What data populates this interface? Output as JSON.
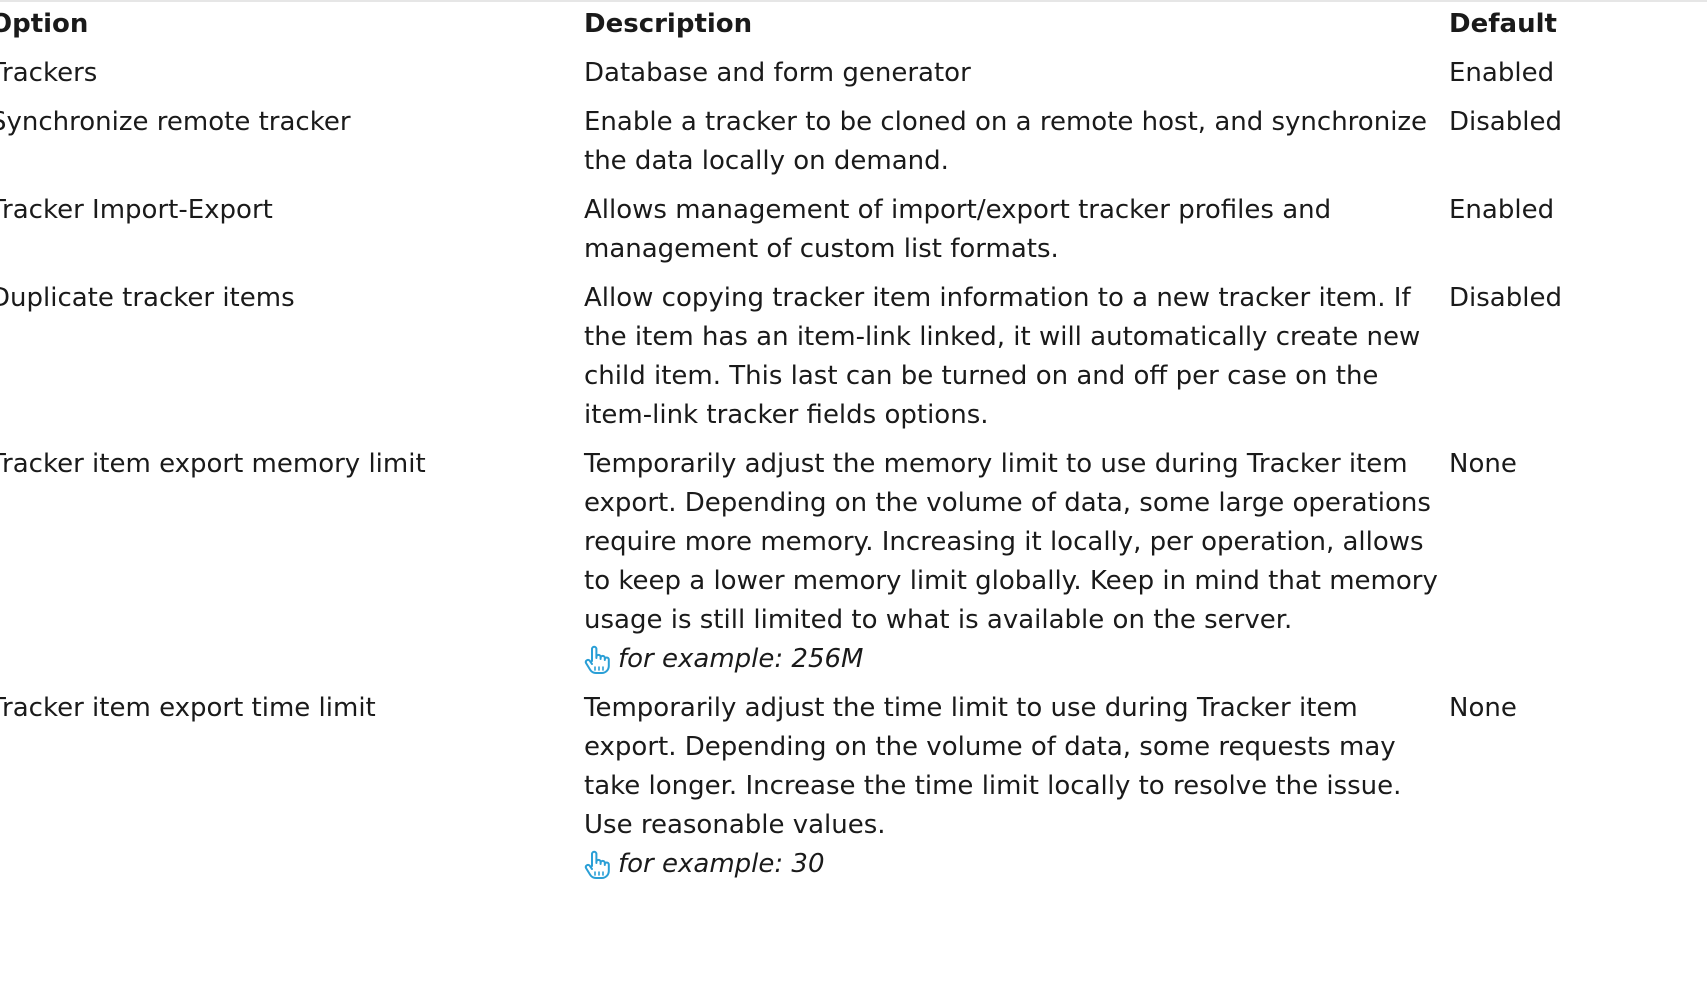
{
  "headers": {
    "option": "Option",
    "description": "Description",
    "default": "Default"
  },
  "rows": [
    {
      "option": "Trackers",
      "description": "Database and form generator",
      "default": "Enabled"
    },
    {
      "option": "Synchronize remote tracker",
      "description": "Enable a tracker to be cloned on a remote host, and synchronize the data locally on demand.",
      "default": "Disabled"
    },
    {
      "option": "Tracker Import-Export",
      "description": "Allows management of import/export tracker profiles and management of custom list formats.",
      "default": "Enabled"
    },
    {
      "option": "Duplicate tracker items",
      "description": "Allow copying tracker item information to a new tracker item. If the item has an item-link linked, it will automatically create new child item. This last can be turned on and off per case on the item-link tracker fields options.",
      "default": "Disabled"
    },
    {
      "option": "Tracker item export memory limit",
      "description": "Temporarily adjust the memory limit to use during Tracker item export. Depending on the volume of data, some large operations require more memory. Increasing it locally, per operation, allows to keep a lower memory limit globally. Keep in mind that memory usage is still limited to what is available on the server.",
      "example": "for example: 256M",
      "default": "None"
    },
    {
      "option": "Tracker item export time limit",
      "description": "Temporarily adjust the time limit to use during Tracker item export. Depending on the volume of data, some requests may take longer. Increase the time limit locally to resolve the issue. Use reasonable values.",
      "example": "for example: 30",
      "default": "None"
    }
  ],
  "colors": {
    "text": "#1a1a1a",
    "icon": "#2a9fd6"
  },
  "icons": {
    "example": "pointing-hand-icon"
  }
}
